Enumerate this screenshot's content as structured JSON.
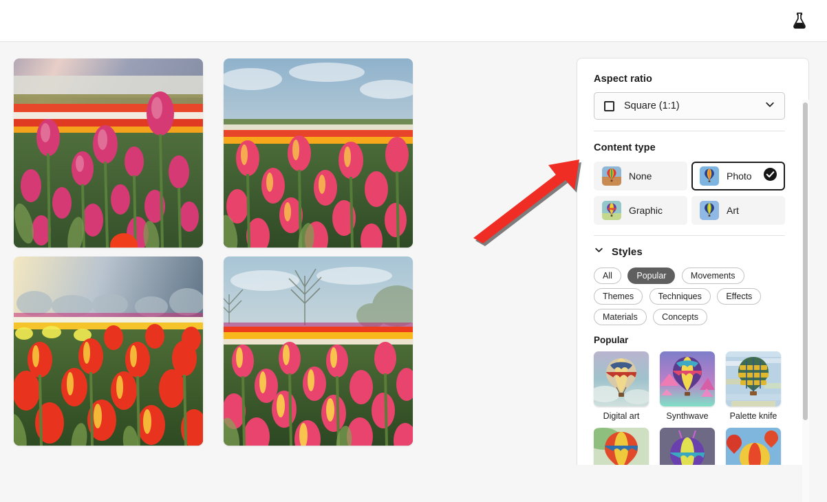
{
  "topbar": {
    "lab_icon": "flask-icon"
  },
  "gallery": {
    "images": [
      {
        "alt": "Pink tulip field with white and red rows under hazy sun"
      },
      {
        "alt": "Pink and orange tulip field with blue sky"
      },
      {
        "alt": "Red and yellow tulip field at sunrise"
      },
      {
        "alt": "Pink and yellow tulip field with bare tree"
      }
    ]
  },
  "panel": {
    "aspect_ratio": {
      "title": "Aspect ratio",
      "selected": "Square (1:1)",
      "icon": "square-icon",
      "chevron": "chevron-down-icon"
    },
    "content_type": {
      "title": "Content type",
      "options": [
        {
          "label": "None",
          "selected": false
        },
        {
          "label": "Photo",
          "selected": true
        },
        {
          "label": "Graphic",
          "selected": false
        },
        {
          "label": "Art",
          "selected": false
        }
      ],
      "check_icon": "check-circle-icon"
    },
    "styles": {
      "title": "Styles",
      "chevron": "chevron-down-icon",
      "filters": [
        {
          "label": "All",
          "active": false
        },
        {
          "label": "Popular",
          "active": true
        },
        {
          "label": "Movements",
          "active": false
        },
        {
          "label": "Themes",
          "active": false
        },
        {
          "label": "Techniques",
          "active": false
        },
        {
          "label": "Effects",
          "active": false
        },
        {
          "label": "Materials",
          "active": false
        },
        {
          "label": "Concepts",
          "active": false
        }
      ],
      "group_title": "Popular",
      "items": [
        {
          "label": "Digital art"
        },
        {
          "label": "Synthwave"
        },
        {
          "label": "Palette knife"
        }
      ]
    }
  },
  "scrollbar": {
    "name": "panel-scrollbar"
  },
  "annotation": {
    "arrow": "red-arrow-pointer",
    "color": "#ef2d24"
  }
}
